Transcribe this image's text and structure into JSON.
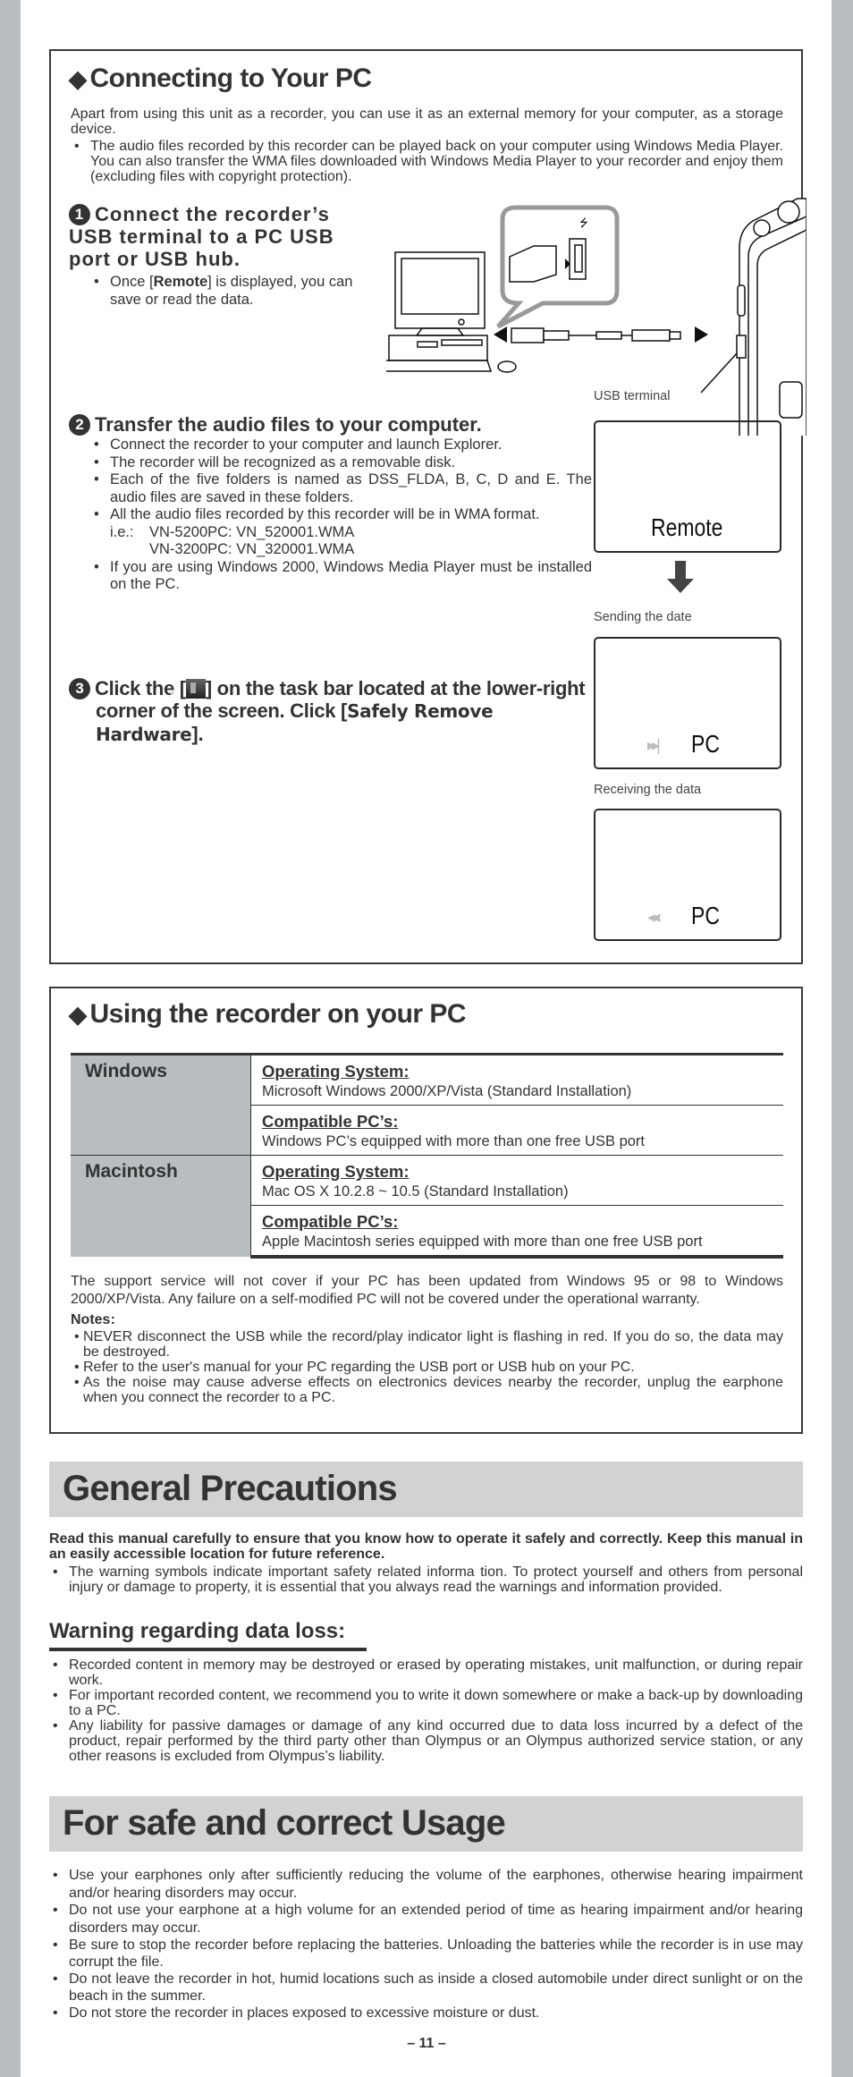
{
  "connecting": {
    "title": "Connecting to Your PC",
    "intro": "Apart from using this unit as a recorder, you can use it as an external memory for your computer, as a storage device.",
    "intro_bullet": "The audio files recorded by this recorder can be played back on your computer using Windows Media Player. You can also transfer the WMA files downloaded with Windows Media Player to your recorder and enjoy them (excluding files with copyright protection).",
    "steps": [
      {
        "num": "1",
        "title": "Connect the recorder’s USB terminal to a PC USB port or USB hub.",
        "bullets": [
          "Once [Remote] is displayed, you can save or read the data."
        ]
      },
      {
        "num": "2",
        "title": "Transfer the audio files to your computer.",
        "bullets": [
          "Connect the recorder to your computer and launch Explorer.",
          "The recorder will be recognized as a removable disk.",
          "Each of the five folders is named as DSS_FLDA, B, C, D and E. The audio files are saved in these folders.",
          "All the audio files recorded by this recorder will be in WMA format.",
          "If you are using Windows 2000, Windows Media Player must be installed on the PC."
        ],
        "example_label": "i.e.:",
        "examples": [
          "VN-5200PC: VN_520001.WMA",
          "VN-3200PC: VN_320001.WMA"
        ]
      },
      {
        "num": "3",
        "title_pre": "Click the [",
        "title_post": "] on the task bar located at the lower-right corner of the screen. Click [",
        "title_bold": "Safely Remove Hardware",
        "title_end": "].",
        "icon": "safely-remove-hardware-icon"
      }
    ],
    "illustration": {
      "usb_terminal_label": "USB terminal"
    },
    "displays": [
      {
        "caption": "",
        "text": "Remote",
        "icon": ""
      },
      {
        "caption": "Sending the date",
        "text": "PC",
        "icon": "send-arrows-icon"
      },
      {
        "caption": "Receiving the data",
        "text": "PC",
        "icon": "receive-arrows-icon"
      }
    ]
  },
  "using": {
    "title": "Using the recorder on your PC",
    "rows": [
      {
        "os": "Windows",
        "entries": [
          {
            "label": "Operating System:",
            "value": "Microsoft Windows 2000/XP/Vista (Standard Installation)"
          },
          {
            "label": "Compatible PC’s:",
            "value": "Windows PC’s equipped with more than one free USB port"
          }
        ]
      },
      {
        "os": "Macintosh",
        "entries": [
          {
            "label": "Operating System:",
            "value": "Mac OS X 10.2.8 ~ 10.5 (Standard Installation)"
          },
          {
            "label": "Compatible PC’s:",
            "value": "Apple Macintosh series equipped with more than one free USB port"
          }
        ]
      }
    ],
    "support_note": "The support service will not cover if your PC has been updated from Windows 95 or 98 to Windows 2000/XP/Vista. Any failure on a self-modified PC will not be covered under the operational warranty.",
    "notes_label": "Notes:",
    "notes": [
      "NEVER disconnect the USB while the record/play indicator light is flashing in red. If you do so, the data may be destroyed.",
      "Refer to the user's manual for your PC regarding the USB port or USB hub on your PC.",
      "As the noise may cause adverse effects on electronics devices nearby the recorder, unplug the earphone when you connect the recorder to a PC."
    ]
  },
  "general": {
    "title": "General Precautions",
    "lead": "Read this manual carefully to ensure that you know how to operate it safely and correctly. Keep this manual in an easily accessible location for future reference.",
    "bullet": "The warning symbols indicate important safety related informa tion. To protect yourself and others from personal injury or damage to property, it is essential that you always read the warnings and information provided.",
    "warning_title": "Warning regarding data loss:",
    "warning_bullets": [
      "Recorded content in memory may be destroyed or erased by operating mistakes, unit malfunction, or during repair work.",
      "For important recorded content, we recommend you to write it down somewhere or make a back-up by downloading to a PC.",
      "Any liability for passive damages or damage of any kind occurred due to data loss incurred by a defect of the product, repair performed by the third party other than Olympus or an Olympus authorized service station, or any other reasons is excluded from Olympus’s liability."
    ]
  },
  "safe_usage": {
    "title": "For safe and correct Usage",
    "bullets": [
      "Use your earphones only after sufficiently reducing the volume of the earphones, otherwise hearing impairment and/or hearing disorders may occur.",
      "Do not use your earphone at a high volume for an extended period of time as hearing impairment and/or hearing disorders may occur.",
      "Be sure to stop the recorder before replacing the batteries. Unloading the batteries while the recorder is in use may corrupt the file.",
      "Do not leave the recorder in hot, humid locations such as inside a closed automobile under direct sunlight or on the beach in the summer.",
      "Do not store the recorder in places exposed to excessive moisture or dust."
    ]
  },
  "page_number": "– 11 –"
}
